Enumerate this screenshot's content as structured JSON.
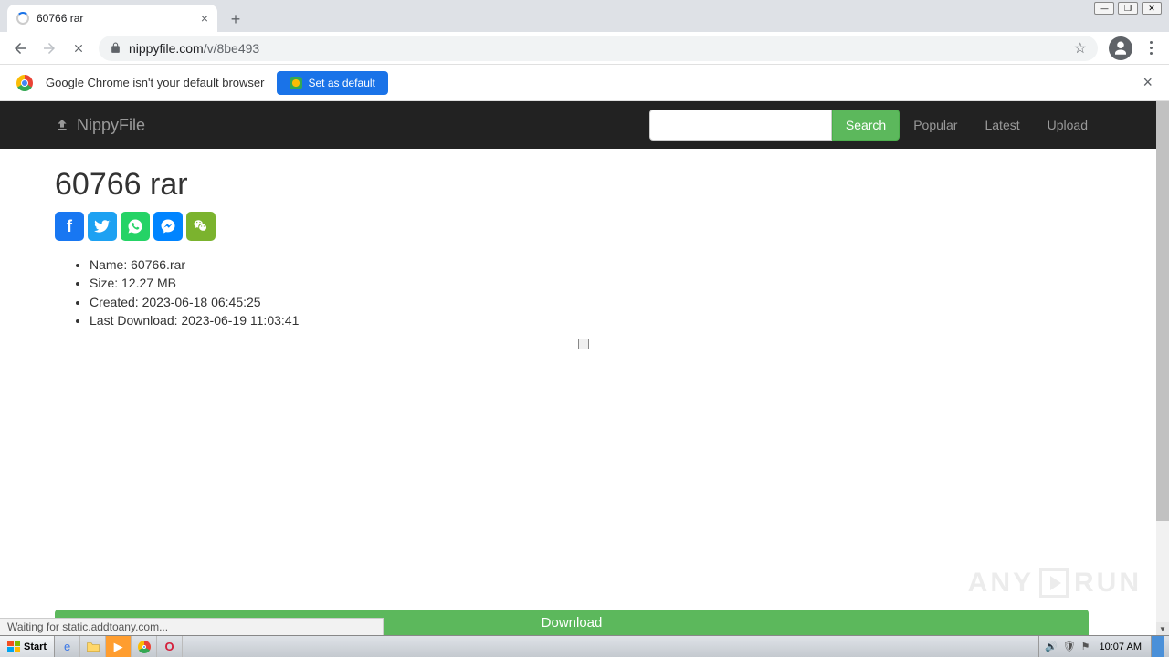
{
  "window": {
    "controls": [
      "minimize",
      "maximize",
      "close"
    ]
  },
  "browser": {
    "tab_title": "60766 rar",
    "url_domain": "nippyfile.com",
    "url_path": "/v/8be493",
    "infobar_text": "Google Chrome isn't your default browser",
    "set_default_label": "Set as default",
    "status_text": "Waiting for static.addtoany.com..."
  },
  "site": {
    "brand": "NippyFile",
    "search_label": "Search",
    "nav_links": [
      "Popular",
      "Latest",
      "Upload"
    ]
  },
  "page": {
    "heading": "60766 rar",
    "share": [
      "facebook",
      "twitter",
      "whatsapp",
      "messenger",
      "wechat"
    ],
    "details": [
      "Name: 60766.rar",
      "Size: 12.27 MB",
      "Created: 2023-06-18 06:45:25",
      "Last Download: 2023-06-19 11:03:41"
    ],
    "download_label": "Download"
  },
  "watermark": {
    "left": "ANY",
    "right": "RUN"
  },
  "taskbar": {
    "start_label": "Start",
    "clock": "10:07 AM"
  }
}
